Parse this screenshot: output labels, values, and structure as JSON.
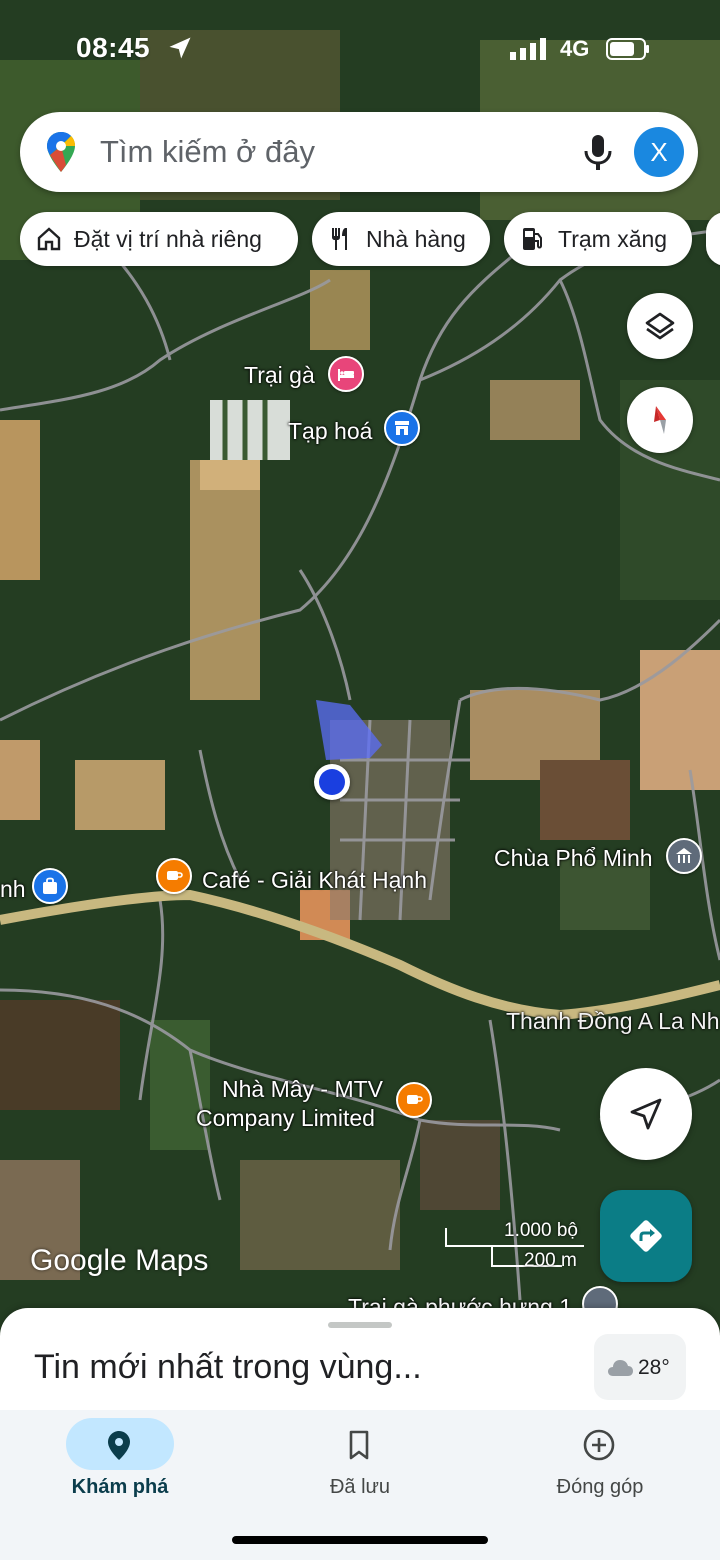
{
  "status_bar": {
    "time": "08:45",
    "network": "4G"
  },
  "search": {
    "placeholder": "Tìm kiếm ở đây",
    "avatar_letter": "X"
  },
  "chips": [
    {
      "label": "Đặt vị trí nhà riêng",
      "icon": "home-icon"
    },
    {
      "label": "Nhà hàng",
      "icon": "restaurant-icon"
    },
    {
      "label": "Trạm xăng",
      "icon": "gas-station-icon"
    }
  ],
  "map": {
    "places": {
      "trai_ga": "Trại gà",
      "tap_hoa": "Tạp hoá",
      "chua": "Chùa Phổ Minh",
      "cafe": "Café - Giải Khát Hạnh",
      "cafe_left": "nh",
      "road": "Thanh Đồng A La Nh",
      "factory_line1": "Nhà Mây - MTV",
      "factory_line2": "Company Limited",
      "farm_bottom": "Trại gà phước hưng 1"
    },
    "poi_colors": {
      "lodging": "#e8457a",
      "shop": "#1a73e8",
      "cafe": "#f57c00",
      "worship": "#5f6b7a"
    },
    "brand": "Google Maps",
    "scale": {
      "imperial": "1.000 bộ",
      "metric": "200 m"
    }
  },
  "sheet": {
    "title": "Tin mới nhất trong vùng...",
    "temperature": "28°"
  },
  "bottom_nav": [
    {
      "label": "Khám phá",
      "icon": "explore-pin-icon",
      "active": true
    },
    {
      "label": "Đã lưu",
      "icon": "bookmark-icon",
      "active": false
    },
    {
      "label": "Đóng góp",
      "icon": "add-circle-icon",
      "active": false
    }
  ],
  "colors": {
    "accent": "#1a88e0",
    "directions": "#0b7d86",
    "nav_active": "#c2e7ff"
  }
}
